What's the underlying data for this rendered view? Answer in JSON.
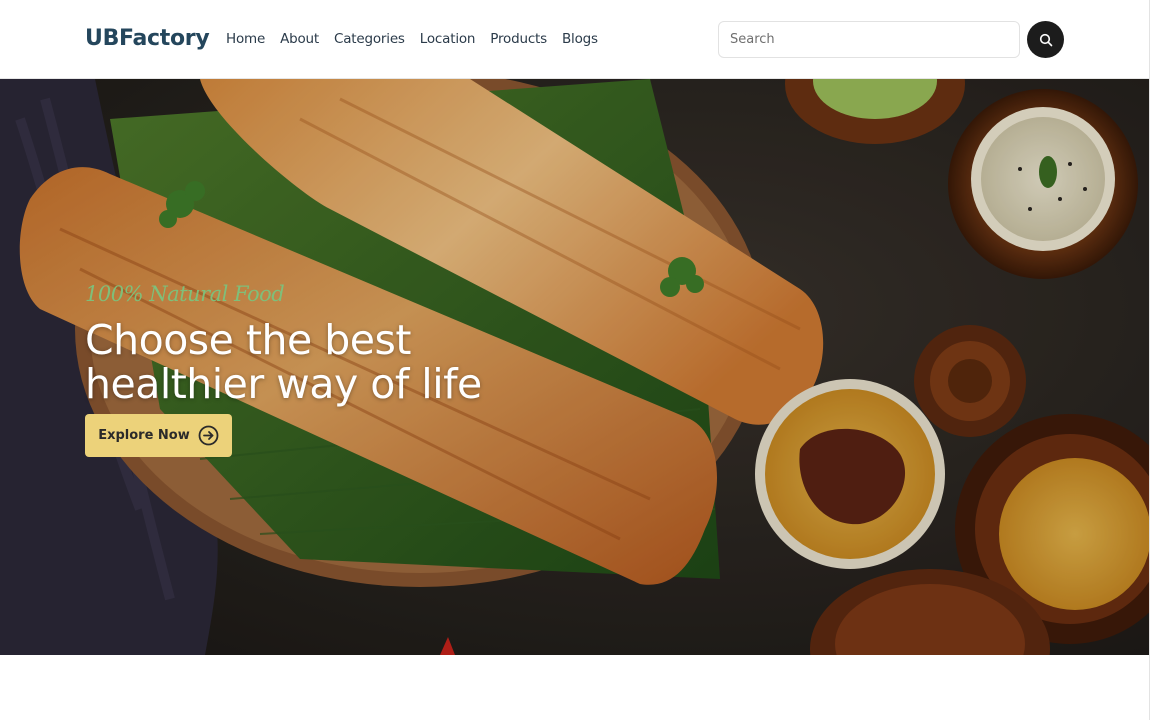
{
  "brand": {
    "name": "UBFactory"
  },
  "nav": {
    "items": [
      {
        "label": "Home"
      },
      {
        "label": "About"
      },
      {
        "label": "Categories"
      },
      {
        "label": "Location"
      },
      {
        "label": "Products"
      },
      {
        "label": "Blogs"
      }
    ]
  },
  "search": {
    "placeholder": "Search",
    "icon": "search-icon"
  },
  "hero": {
    "tagline": "100% Natural Food",
    "headline_line1": "Choose the best",
    "headline_line2": "healthier way of life",
    "cta_label": "Explore Now",
    "cta_icon": "arrow-right-circle-icon",
    "image": "dosa-with-chutneys-photo"
  },
  "colors": {
    "brand": "#24465c",
    "cta": "#ecd27a",
    "tagline": "#7fbf7a",
    "search_button": "#1c1c1c"
  }
}
